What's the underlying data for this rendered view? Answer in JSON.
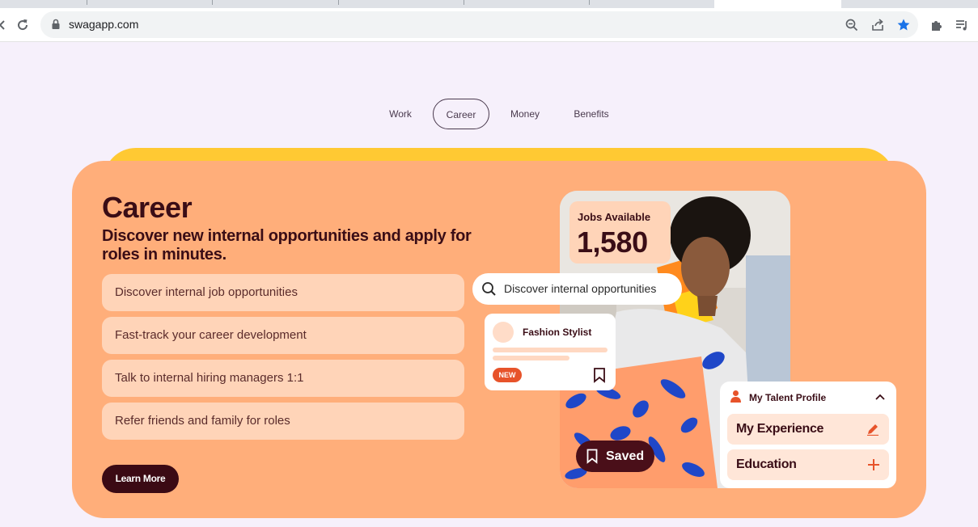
{
  "browser": {
    "url": "swagapp.com"
  },
  "nav": {
    "items": [
      "Work",
      "Career",
      "Money",
      "Benefits"
    ],
    "active": "Career"
  },
  "hero": {
    "title": "Career",
    "subtitle": "Discover new internal opportunities and apply for roles in minutes.",
    "features": [
      "Discover internal job opportunities",
      "Fast-track your career development",
      "Talk to internal hiring managers 1:1",
      "Refer friends and family for roles"
    ],
    "cta": "Learn More"
  },
  "mockup": {
    "jobs_label": "Jobs Available",
    "jobs_value": "1,580",
    "search_text": "Discover internal opportunities",
    "job_card_title": "Fashion Stylist",
    "new_badge": "NEW",
    "saved_label": "Saved",
    "talent_header": "My Talent Profile",
    "talent_rows": [
      "My Experience",
      "Education"
    ]
  },
  "colors": {
    "page_bg": "#f6f0fb",
    "orange_card": "#ffae7a",
    "yellow_card": "#ffc933",
    "dark_maroon": "#3b0a14",
    "accent_orange": "#e7532a",
    "star_blue": "#1a73e8"
  },
  "icons": {
    "back": "back-arrow-icon",
    "reload": "reload-icon",
    "lock": "lock-icon",
    "zoom": "zoom-icon",
    "share": "share-icon",
    "star": "star-icon",
    "extensions": "puzzle-icon",
    "media": "media-queue-icon",
    "search": "search-icon",
    "bookmark": "bookmark-icon",
    "person": "person-icon",
    "chevron": "chevron-up-icon",
    "edit": "pencil-icon",
    "add": "plus-icon"
  }
}
